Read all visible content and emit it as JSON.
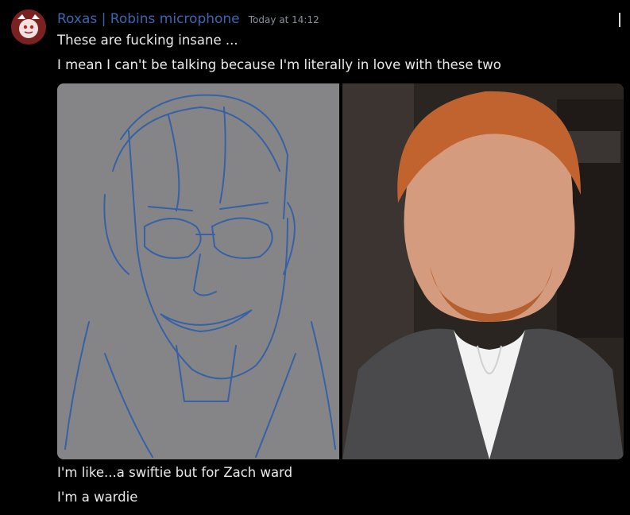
{
  "message": {
    "author": "Roxas | Robins microphone",
    "timestamp": "Today at 14:12",
    "lines": [
      "These are fucking insane ...",
      "I mean I can't be talking because I'm literally in love with these two"
    ],
    "followups": [
      "I'm like...a swiftie but for Zach ward",
      "I'm a wardie"
    ],
    "attachments": [
      {
        "kind": "sketch",
        "name": "blue line sketch of smiling man with glasses"
      },
      {
        "kind": "photo",
        "name": "photo of red-haired man in grey suit"
      }
    ]
  },
  "colors": {
    "background": "#000000",
    "username": "#3b66b0",
    "text": "#e9eaec",
    "timestamp": "#8a8f98"
  }
}
